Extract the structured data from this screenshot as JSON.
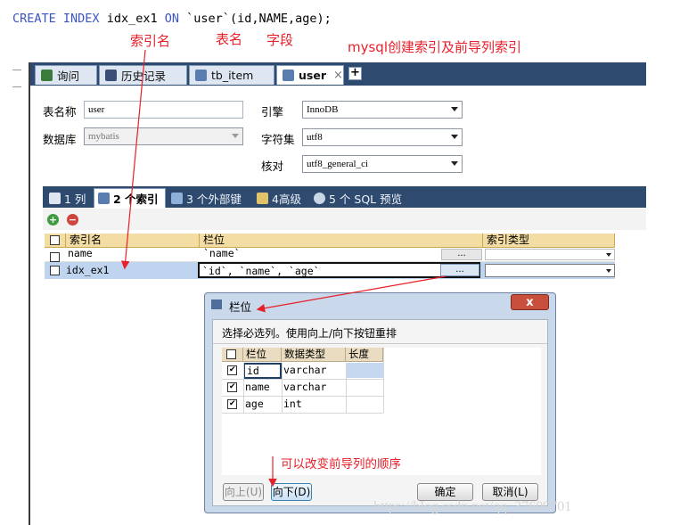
{
  "sql": {
    "create": "CREATE",
    "index": "INDEX",
    "name": "idx_ex1",
    "on": "ON",
    "table": "`user`",
    "cols": "(id,NAME,age);"
  },
  "annotations": {
    "index_name": "索引名",
    "table_name": "表名",
    "field": "字段",
    "title": "mysql创建索引及前导列索引",
    "reorder": "可以改变前导列的顺序"
  },
  "tabs": [
    {
      "label": "询问",
      "icon": "query-icon"
    },
    {
      "label": "历史记录",
      "icon": "history-icon"
    },
    {
      "label": "tb_item",
      "icon": "table-icon"
    },
    {
      "label": "user",
      "icon": "table-design-icon",
      "active": true
    }
  ],
  "tab_close": "×",
  "tab_add": "+",
  "form": {
    "table_name_label": "表名称",
    "table_name_value": "user",
    "database_label": "数据库",
    "database_value": "mybatis",
    "engine_label": "引擎",
    "engine_value": "InnoDB",
    "charset_label": "字符集",
    "charset_value": "utf8",
    "collation_label": "核对",
    "collation_value": "utf8_general_ci"
  },
  "subtabs": [
    {
      "label": "1 列",
      "icon": "columns-icon"
    },
    {
      "label": "2 个索引",
      "icon": "index-icon",
      "active": true
    },
    {
      "label": "3 个外部键",
      "icon": "foreign-key-icon"
    },
    {
      "label": "4高级",
      "icon": "advanced-icon"
    },
    {
      "label": "5 个 SQL 预览",
      "icon": "sql-preview-icon"
    }
  ],
  "toolbar": {
    "add": "+",
    "remove": "−"
  },
  "grid": {
    "headers": [
      "索引名",
      "栏位",
      "索引类型"
    ],
    "rows": [
      {
        "name": "name",
        "columns": "`name`",
        "more": "...",
        "type": ""
      },
      {
        "name": "idx_ex1",
        "columns": "`id`, `name`, `age`",
        "more": "...",
        "type": ""
      }
    ]
  },
  "dialog": {
    "title": "栏位",
    "close": "x",
    "instruction": "选择必选列。使用向上/向下按钮重排",
    "headers": [
      "栏位",
      "数据类型",
      "长度"
    ],
    "rows": [
      {
        "name": "id",
        "type": "varchar",
        "length": ""
      },
      {
        "name": "name",
        "type": "varchar",
        "length": ""
      },
      {
        "name": "age",
        "type": "int",
        "length": ""
      }
    ],
    "up": "向上(U)",
    "down": "向下(D)",
    "ok": "确定",
    "cancel": "取消(L)"
  },
  "watermark": "https://blog.csdn.net/qq_37609701",
  "colors": {
    "accent_red": "#e8202a",
    "keyword_blue": "#3a55c0",
    "tab_bar": "#2e4a6e"
  }
}
